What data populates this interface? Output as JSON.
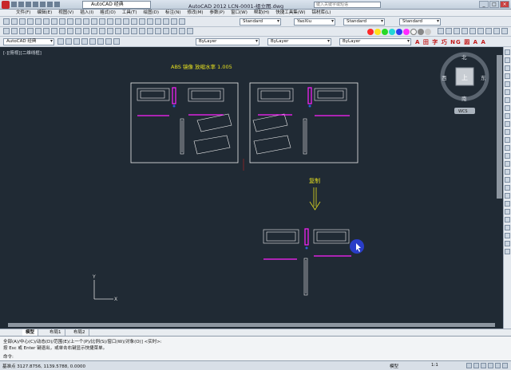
{
  "titlebar": {
    "workspace": "AutoCAD 经典",
    "title": "AutoCAD 2012    LCN-0001-组立图.dwg",
    "search_placeholder": "键入关键字或短语"
  },
  "menu": [
    "文件(F)",
    "编辑(E)",
    "视图(V)",
    "插入(I)",
    "格式(O)",
    "工具(T)",
    "绘图(D)",
    "标注(N)",
    "修改(M)",
    "参数(P)",
    "窗口(W)",
    "帮助(H)",
    "快捷工具集(W)",
    "铝材库(L)"
  ],
  "toolbar": {
    "text_style": "Standard",
    "dim_style": "YaoXiu",
    "table_style": "Standard",
    "mleader_style": "Standard",
    "workspace2": "AutoCAD 经典",
    "layer": "ByLayer",
    "linetype": "ByLayer",
    "lineweight": "ByLayer",
    "font_tools": "A 田 字 巧 NG 圆 A A"
  },
  "canvas": {
    "view_label": "[-][俯视][二维线框]",
    "annotation_top": "ABS    镜像   放缩水率   1.005",
    "annotation_copy": "复制",
    "axis_y": "Y",
    "axis_x": "X"
  },
  "viewcube": {
    "north": "北",
    "south": "南",
    "east": "东",
    "west": "西",
    "top": "上",
    "wcs": "WCS"
  },
  "tabs": [
    "模型",
    "布局1",
    "布局2"
  ],
  "command": {
    "line1": "全部(A)/中心(C)/动态(D)/范围(E)/上一个(P)/比例(S)/窗口(W)/对象(O)] <实时>:",
    "line2": "按 Esc 或 Enter 键退出，或单击右键显示快捷菜单。",
    "prompt": "命令:"
  },
  "status": {
    "coords": "基准点 3127.8756, 1139.5788, 0.0000",
    "mode": "模型",
    "scale": "1:1"
  },
  "colors": {
    "background": "#202a34",
    "magenta": "#ff22ff",
    "yellow": "#e6e01f",
    "white": "#f2f2f2",
    "cursor": "#2a3fd8"
  }
}
